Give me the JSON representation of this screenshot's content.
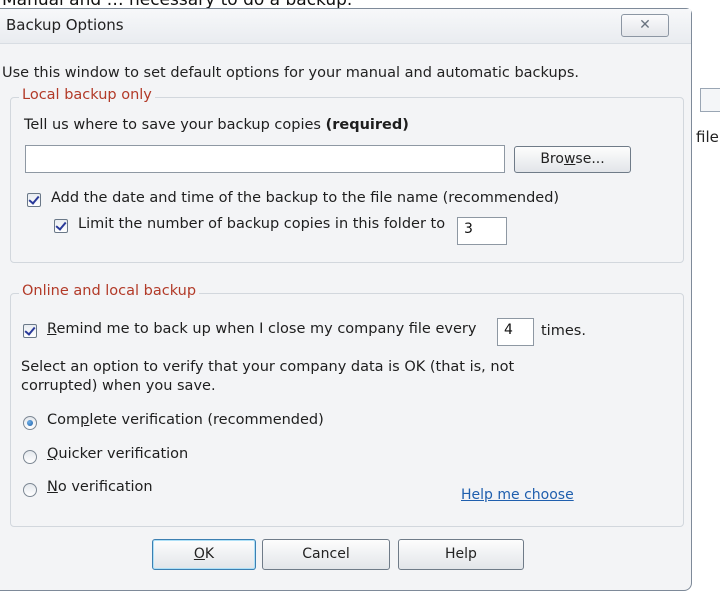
{
  "background": {
    "top_text": "Manual and … necessary to do a backup.",
    "side_text": "file"
  },
  "dialog": {
    "title": "Backup Options",
    "close_glyph": "✕",
    "intro": "Use this window to set default options for your manual and automatic backups."
  },
  "local": {
    "legend": "Local backup only",
    "save_prompt": "Tell us where to save your backup copies",
    "save_required": "(required)",
    "path_value": "",
    "browse_pre": "Bro",
    "browse_mn": "w",
    "browse_post": "se...",
    "add_date_label": "Add the date and time of the backup to the file name (recommended)",
    "limit_label": "Limit the number of backup copies in this folder to",
    "limit_value": "3",
    "add_date_checked": true,
    "limit_checked": true
  },
  "online": {
    "legend": "Online and local backup",
    "remind_mn": "R",
    "remind_rest": "emind me to back up when I close my company file every",
    "remind_value": "4",
    "remind_suffix": "times.",
    "remind_checked": true,
    "verify_line1": "Select an option to verify that your company data is OK (that is, not",
    "verify_line2": "corrupted) when you save.",
    "opt_complete_pre": "Com",
    "opt_complete_mn": "p",
    "opt_complete_post": "lete verification (recommended)",
    "opt_quicker_mn": "Q",
    "opt_quicker_post": "uicker verification",
    "opt_none_mn": "N",
    "opt_none_post": "o verification",
    "selected_option": "complete",
    "help_link": "Help me choose"
  },
  "buttons": {
    "ok_mn": "O",
    "ok_post": "K",
    "cancel": "Cancel",
    "help": "Help"
  },
  "colors": {
    "legend": "#b23a28",
    "link": "#1f5fae",
    "dialog_bg": "#f3f4f6"
  }
}
